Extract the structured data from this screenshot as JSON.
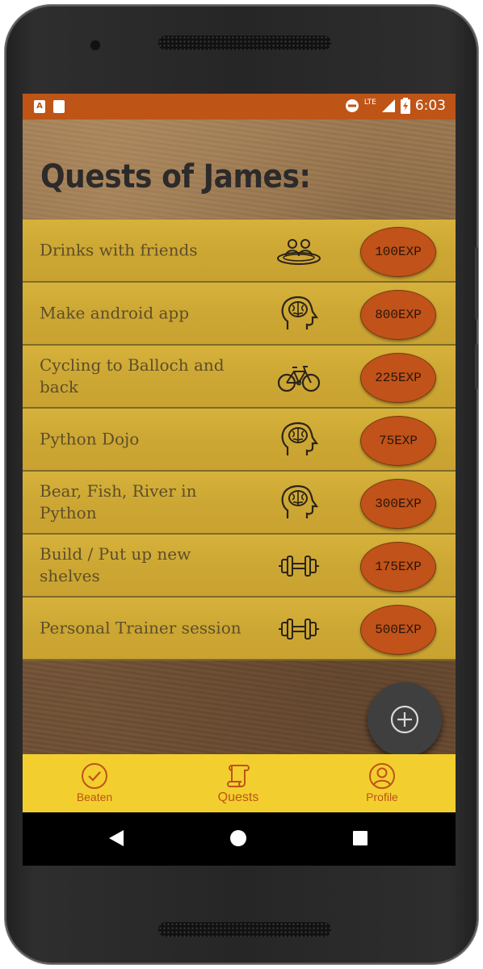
{
  "status_bar": {
    "time": "6:03",
    "network": "LTE"
  },
  "page_title": "Quests of James:",
  "quests": [
    {
      "label": "Drinks with friends",
      "icon": "friends-icon",
      "exp": "100EXP"
    },
    {
      "label": "Make android app",
      "icon": "brain-icon",
      "exp": "800EXP"
    },
    {
      "label": "Cycling to Balloch and back",
      "icon": "bicycle-icon",
      "exp": "225EXP"
    },
    {
      "label": "Python Dojo",
      "icon": "brain-icon",
      "exp": "75EXP"
    },
    {
      "label": "Bear, Fish, River in Python",
      "icon": "brain-icon",
      "exp": "300EXP"
    },
    {
      "label": "Build / Put up new shelves",
      "icon": "dumbbell-icon",
      "exp": "175EXP"
    },
    {
      "label": "Personal Trainer session",
      "icon": "dumbbell-icon",
      "exp": "500EXP"
    }
  ],
  "bottom_nav": {
    "items": [
      {
        "label": "Beaten",
        "icon": "check-circle-icon"
      },
      {
        "label": "Quests",
        "icon": "scroll-icon",
        "active": true
      },
      {
        "label": "Profile",
        "icon": "person-circle-icon"
      }
    ]
  },
  "colors": {
    "accent": "#c0521a",
    "status_bar": "#bf5417",
    "row": "#d1ab36",
    "nav_bar": "#f2cf2e",
    "fab": "#3f3f3f"
  }
}
